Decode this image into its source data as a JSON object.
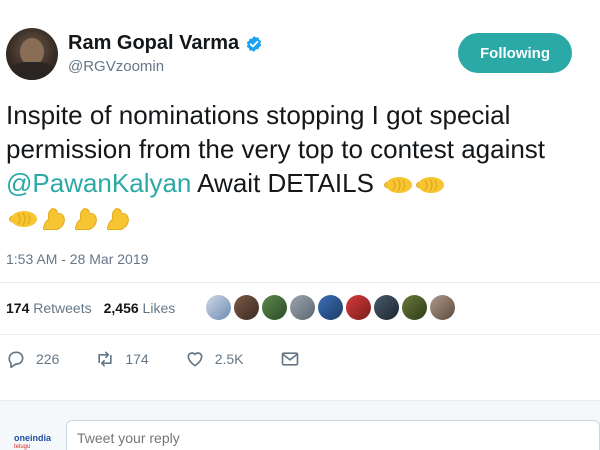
{
  "author": {
    "display_name": "Ram Gopal Varma",
    "handle": "@RGVzoomin",
    "verified": true
  },
  "follow_button": {
    "label": "Following",
    "color": "#2ba9a6"
  },
  "tweet": {
    "text_part1": "Inspite of nominations stopping I got special permission from the very top to contest against ",
    "mention": "@PawanKalyan",
    "text_part2": " Await DETAILS ",
    "emoji_icons": [
      "left-facing-fist-icon",
      "left-facing-fist-icon",
      "left-facing-fist-icon",
      "flexed-biceps-icon",
      "flexed-biceps-icon",
      "flexed-biceps-icon"
    ],
    "timestamp": "1:53 AM - 28 Mar 2019"
  },
  "stats": {
    "retweets_count": "174",
    "retweets_label": "Retweets",
    "likes_count": "2,456",
    "likes_label": "Likes"
  },
  "actions": {
    "replies": "226",
    "retweets": "174",
    "likes": "2.5K"
  },
  "reply": {
    "placeholder": "Tweet your reply"
  },
  "watermark": {
    "brand": "oneindia",
    "sub": "telugu"
  }
}
